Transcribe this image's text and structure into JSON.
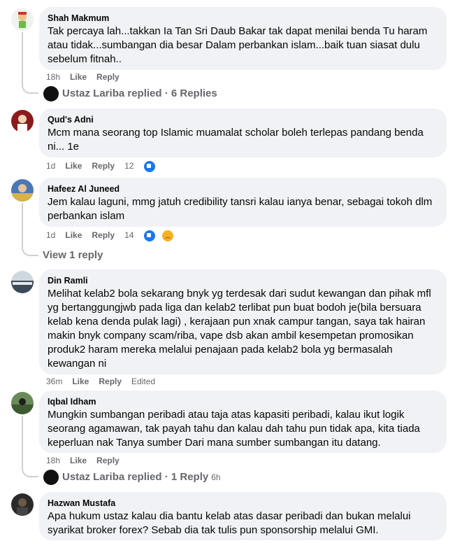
{
  "comments": [
    {
      "name": "Shah Makmum",
      "text": "Tak percaya lah...takkan Ia Tan Sri Daub Bakar tak dapat menilai benda Tu haram atau tidak...sumbangan dia besar Dalam perbankan islam...baik tuan siasat dulu sebelum fitnah..",
      "time": "18h",
      "like": "Like",
      "reply": "Reply"
    },
    {
      "name": "Qud's Adni",
      "text": "Mcm mana seorang top Islamic muamalat scholar boleh terlepas pandang benda ni... 1e",
      "time": "1d",
      "like": "Like",
      "reply": "Reply",
      "reactions": "12"
    },
    {
      "name": "Hafeez Al Juneed",
      "text": "Jem kalau laguni, mmg jatuh credibility tansri kalau ianya benar, sebagai tokoh dlm perbankan islam",
      "time": "1d",
      "like": "Like",
      "reply": "Reply",
      "reactions": "14"
    },
    {
      "name": "Din Ramli",
      "text": "Melihat kelab2 bola sekarang bnyk yg terdesak dari sudut kewangan dan pihak mfl yg bertanggungjwb pada liga dan kelab2 terlibat pun buat bodoh je(bila bersuara kelab kena denda pulak lagi) , kerajaan pun xnak campur tangan, saya tak hairan makin bnyk company scam/riba, vape dsb akan ambil kesempetan promosikan produk2 haram mereka melalui penajaan pada kelab2 bola yg bermasalah kewangan ni",
      "time": "36m",
      "like": "Like",
      "reply": "Reply",
      "edited": "Edited"
    },
    {
      "name": "Iqbal Idham",
      "text": "Mungkin sumbangan peribadi atau taja atas kapasiti peribadi, kalau ikut logik seorang agamawan, tak payah tahu dan kalau dah tahu pun tidak apa, kita tiada keperluan nak Tanya sumber Dari mana sumber sumbangan itu datang.",
      "time": "18h",
      "like": "Like",
      "reply": "Reply"
    },
    {
      "name": "Hazwan Mustafa",
      "text": "Apa hukum ustaz kalau dia bantu kelab atas dasar peribadi dan bukan melalui syarikat broker forex? Sebab dia tak tulis pun sponsorship melalui GMI."
    }
  ],
  "replies": {
    "r1": "Ustaz Lariba replied · 6 Replies",
    "r3": "View 1 reply",
    "r5": "Ustaz Lariba replied · 1 Reply",
    "r5_time": "6h"
  },
  "colors": {
    "bubble": "#f0f2f5",
    "meta": "#65676b",
    "like_blue": "#1877f2"
  }
}
